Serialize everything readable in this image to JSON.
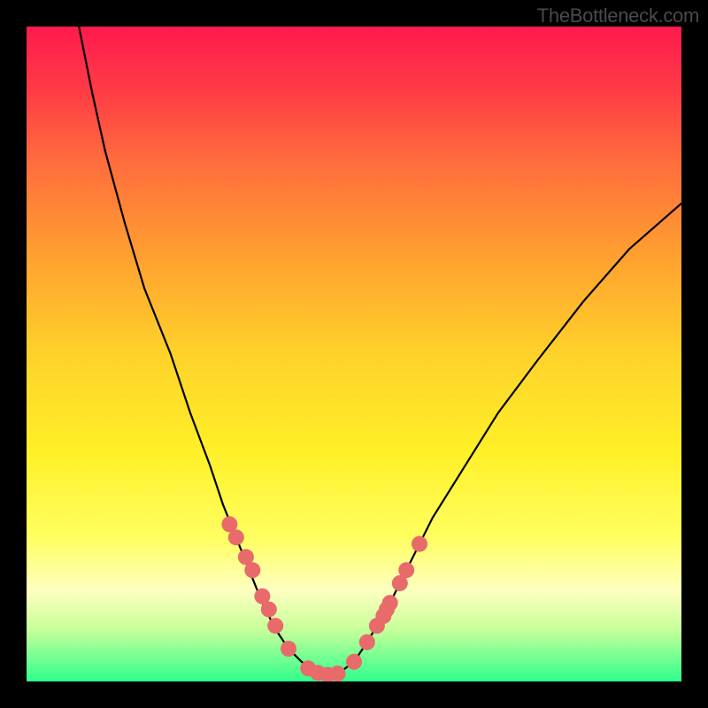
{
  "watermark": "TheBottleneck.com",
  "chart_data": {
    "type": "line",
    "title": "",
    "xlabel": "",
    "ylabel": "",
    "xlim": [
      0,
      100
    ],
    "ylim": [
      0,
      100
    ],
    "series": [
      {
        "name": "bottleneck-curve",
        "x": [
          8,
          10,
          12,
          15,
          18,
          22,
          25,
          28,
          30,
          32,
          34,
          36,
          38,
          40,
          42,
          44,
          45,
          46,
          48,
          50,
          52,
          55,
          58,
          62,
          67,
          72,
          78,
          85,
          92,
          100
        ],
        "y": [
          100,
          90,
          81,
          70,
          60,
          50,
          41,
          33,
          27,
          22,
          17,
          12,
          8,
          5,
          3,
          1.5,
          1,
          1,
          1.5,
          3,
          6,
          11,
          17,
          25,
          33,
          41,
          49,
          58,
          66,
          73
        ]
      }
    ],
    "markers": {
      "name": "highlight-points",
      "color": "#e86a6a",
      "x": [
        31,
        32,
        33.5,
        34.5,
        36,
        37,
        38,
        40,
        43,
        44.5,
        46,
        47.5,
        50,
        52,
        53.5,
        54.5,
        55,
        55.5,
        57,
        58,
        60
      ],
      "y": [
        24,
        22,
        19,
        17,
        13,
        11,
        8.5,
        5,
        2,
        1.3,
        1,
        1.2,
        3,
        6,
        8.5,
        10,
        11,
        12,
        15,
        17,
        21
      ]
    },
    "gradient_stops": [
      {
        "pct": 0,
        "color": "#ff1a4d"
      },
      {
        "pct": 50,
        "color": "#ffd22a"
      },
      {
        "pct": 78,
        "color": "#ffff60"
      },
      {
        "pct": 100,
        "color": "#2fff8c"
      }
    ]
  }
}
